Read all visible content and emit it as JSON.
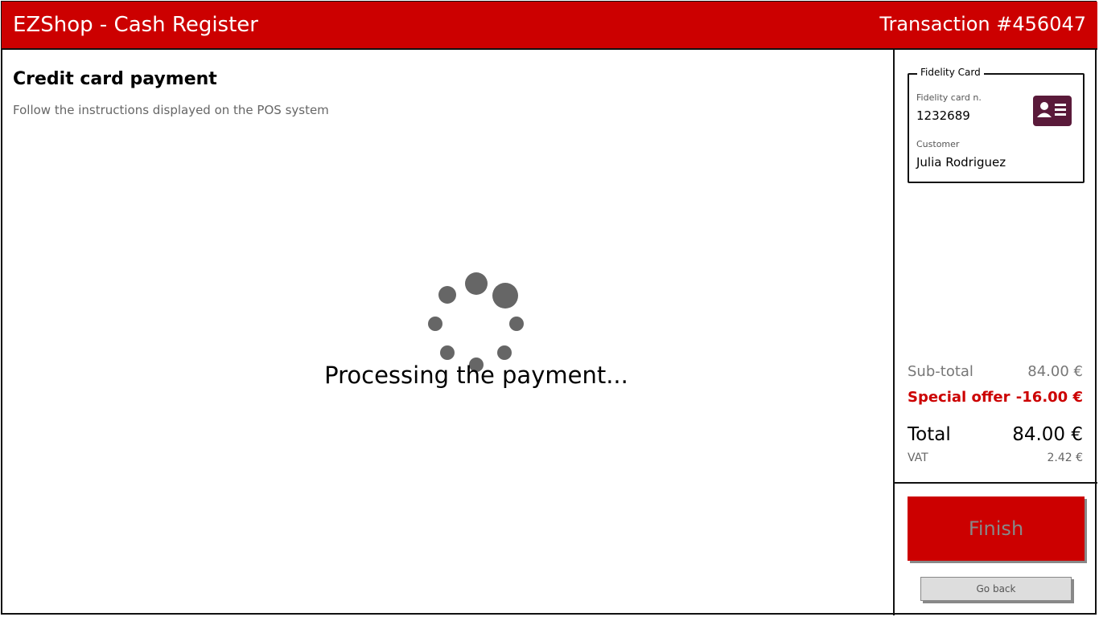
{
  "header": {
    "app_title": "EZShop - Cash Register",
    "transaction": "Transaction #456047"
  },
  "main": {
    "title": "Credit card payment",
    "subtitle": "Follow the instructions displayed on the POS system",
    "status": "Processing the payment..."
  },
  "fidelity_card": {
    "legend": "Fidelity Card",
    "card_label": "Fidelity card n.",
    "card_number": "1232689",
    "customer_label": "Customer",
    "customer_name": "Julia Rodriguez",
    "icon": "id-card-icon"
  },
  "totals": {
    "subtotal_label": "Sub-total",
    "subtotal_value": "84.00 €",
    "offer_label": "Special offer",
    "offer_value": "-16.00 €",
    "total_label": "Total",
    "total_value": "84.00 €",
    "vat_label": "VAT",
    "vat_value": "2.42 €"
  },
  "actions": {
    "finish_label": "Finish",
    "goback_label": "Go back"
  },
  "colors": {
    "accent": "#cc0000",
    "card_icon": "#5a1a3a",
    "spinner": "#666666"
  }
}
